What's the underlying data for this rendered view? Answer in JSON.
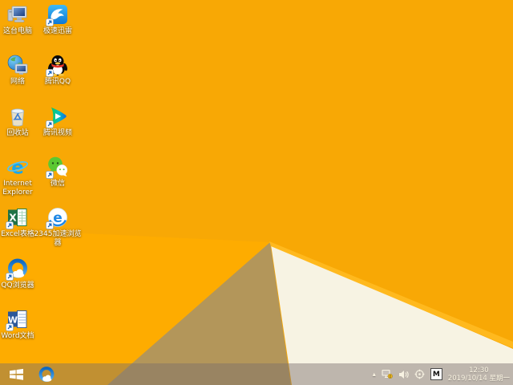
{
  "wallpaper": {
    "name": "windows-8-orange-folded-paper",
    "colors": {
      "base_orange": "#F8A805",
      "bright_orange": "#FEAC00",
      "tan_fold": "#B3965A",
      "cream_fold": "#F7F3E3",
      "ridge_yellow": "#FFB91E"
    }
  },
  "desktop_icons": [
    {
      "label": "这台电脑",
      "icon": "this-pc",
      "shortcut": false
    },
    {
      "label": "极速迅雷",
      "icon": "xunlei",
      "shortcut": true
    },
    {
      "label": "网络",
      "icon": "network",
      "shortcut": false
    },
    {
      "label": "腾讯QQ",
      "icon": "tencent-qq",
      "shortcut": true
    },
    {
      "label": "回收站",
      "icon": "recycle-bin",
      "shortcut": false
    },
    {
      "label": "腾讯视频",
      "icon": "tencent-video",
      "shortcut": true
    },
    {
      "label": "Internet Explorer",
      "icon": "internet-explorer",
      "shortcut": false
    },
    {
      "label": "微信",
      "icon": "wechat",
      "shortcut": true
    },
    {
      "label": "Excel表格",
      "icon": "excel",
      "shortcut": true
    },
    {
      "label": "2345加速浏览器",
      "icon": "browser-2345",
      "shortcut": true
    },
    {
      "label": "QQ浏览器",
      "icon": "qq-browser",
      "shortcut": true
    },
    {
      "label": "Word文档",
      "icon": "word",
      "shortcut": true
    }
  ],
  "taskbar": {
    "pinned": [
      {
        "icon": "qq-browser"
      }
    ],
    "tray": {
      "hidden_icons_arrow": "▴",
      "icons": [
        "network-status",
        "volume",
        "safety-center",
        "input-method"
      ],
      "input_method_label": "M",
      "clock_time": "12:30",
      "clock_date": "2019/10/14 星期一"
    }
  }
}
